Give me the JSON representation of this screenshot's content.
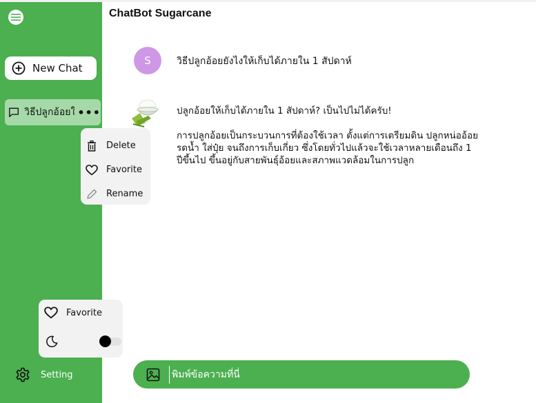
{
  "app": {
    "title": "ChatBot Sugarcane"
  },
  "sidebar": {
    "new_chat_label": "New Chat",
    "chat_items": [
      {
        "label": "วิธีปลูกอ้อยให้",
        "more": "•••"
      }
    ],
    "context_menu": {
      "delete": "Delete",
      "favorite": "Favorite",
      "rename": "Rename"
    },
    "bottom_panel": {
      "favorite": "Favorite",
      "dark_mode_on": false
    },
    "setting_label": "Setting"
  },
  "chat": {
    "user_avatar_letter": "S",
    "user_message": "วิธีปลูกอ้อยยังไงให้เก็บได้ภายใน 1 สัปดาห์",
    "bot_message_line1": "ปลูกอ้อยให้เก็บได้ภายใน 1 สัปดาห์? เป็นไปไม่ได้ครับ!",
    "bot_message_line2": "การปลูกอ้อยเป็นกระบวนการที่ต้องใช้เวลา ตั้งแต่การเตรียมดิน ปลูกหน่ออ้อย รดน้ำ ใส่ปุ๋ย จนถึงการเก็บเกี่ยว ซึ่งโดยทั่วไปแล้วจะใช้เวลาหลายเดือนถึง 1 ปีขึ้นไป ขึ้นอยู่กับสายพันธุ์อ้อยและสภาพแวดล้อมในการปลูก"
  },
  "input": {
    "placeholder": "พิมพ์ข้อความที่นี่"
  },
  "colors": {
    "sidebar": "#4caf50",
    "active_item": "#a6d9a8",
    "avatar": "#cf98e6",
    "panel": "#f2f2f2"
  },
  "icons": [
    "menu-icon",
    "plus-circle-icon",
    "chat-bubble-icon",
    "trash-icon",
    "heart-icon",
    "pencil-icon",
    "moon-icon",
    "gear-icon",
    "image-icon"
  ]
}
